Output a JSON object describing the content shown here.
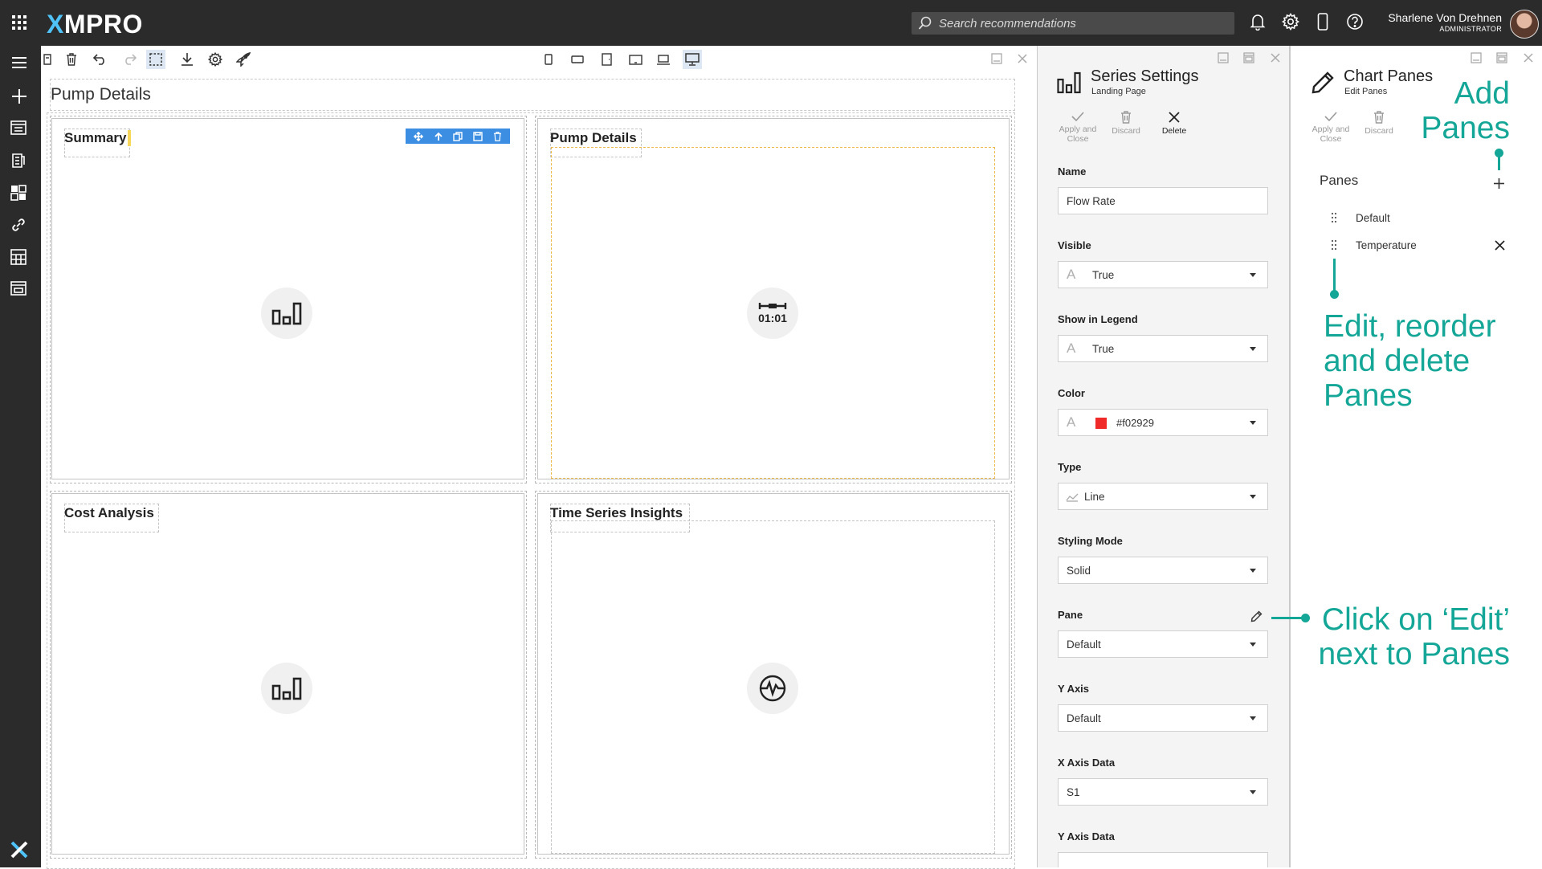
{
  "app": {
    "logo_x": "X",
    "logo_rest": "MPRO"
  },
  "topbar": {
    "search_placeholder": "Search recommendations",
    "user_name": "Sharlene Von Drehnen",
    "user_role": "ADMINISTRATOR",
    "icons": [
      "apps-grid-icon",
      "search-icon",
      "bell-icon",
      "gear-icon",
      "phone-icon",
      "help-icon"
    ]
  },
  "leftrail": {
    "icons": [
      "hamburger-icon",
      "plus-icon",
      "app-list-icon",
      "document-icon",
      "dashboard-icon",
      "link-icon",
      "calculator-icon",
      "window-icon",
      "xmpro-logo-icon"
    ]
  },
  "toolbar": {
    "icons": [
      "save-icon",
      "delete-icon",
      "undo-icon",
      "redo-icon",
      "select-icon",
      "download-icon",
      "settings-icon",
      "rocket-icon"
    ],
    "device_icons": [
      "phone-portrait-icon",
      "phone-landscape-icon",
      "tablet-portrait-icon",
      "tablet-landscape-icon",
      "laptop-icon",
      "desktop-icon"
    ]
  },
  "canvas": {
    "page_title": "Pump Details",
    "cards": [
      {
        "title": "Summary",
        "icon": "bar-chart-icon"
      },
      {
        "title": "Pump Details",
        "icon": "timer-icon"
      },
      {
        "title": "Cost Analysis",
        "icon": "bar-chart-icon"
      },
      {
        "title": "Time Series Insights",
        "icon": "pulse-icon"
      }
    ]
  },
  "series_settings": {
    "title": "Series Settings",
    "subtitle": "Landing Page",
    "actions": {
      "apply_line1": "Apply and",
      "apply_line2": "Close",
      "discard": "Discard",
      "delete": "Delete"
    },
    "fields": {
      "name_label": "Name",
      "name_value": "Flow Rate",
      "visible_label": "Visible",
      "visible_value": "True",
      "legend_label": "Show in Legend",
      "legend_value": "True",
      "color_label": "Color",
      "color_value": "#f02929",
      "type_label": "Type",
      "type_value": "Line",
      "styling_label": "Styling Mode",
      "styling_value": "Solid",
      "pane_label": "Pane",
      "pane_value": "Default",
      "yaxis_label": "Y Axis",
      "yaxis_value": "Default",
      "xdata_label": "X Axis Data",
      "xdata_value": "S1",
      "ydata_label": "Y Axis Data"
    }
  },
  "chart_panes": {
    "title": "Chart Panes",
    "subtitle": "Edit Panes",
    "actions": {
      "apply_line1": "Apply and",
      "apply_line2": "Close",
      "discard": "Discard"
    },
    "panes_heading": "Panes",
    "panes": [
      "Default",
      "Temperature"
    ]
  },
  "annotations": {
    "add_panes_1": "Add",
    "add_panes_2": "Panes",
    "edit_1": "Edit, reorder",
    "edit_2": "and delete",
    "edit_3": "Panes",
    "click_1": "Click on ‘Edit’",
    "click_2": "next to Panes"
  },
  "colors": {
    "topbar": "#2b2b2b",
    "accent_blue": "#3c8ee3",
    "annotation_teal": "#14a697",
    "series_color": "#f02929"
  }
}
